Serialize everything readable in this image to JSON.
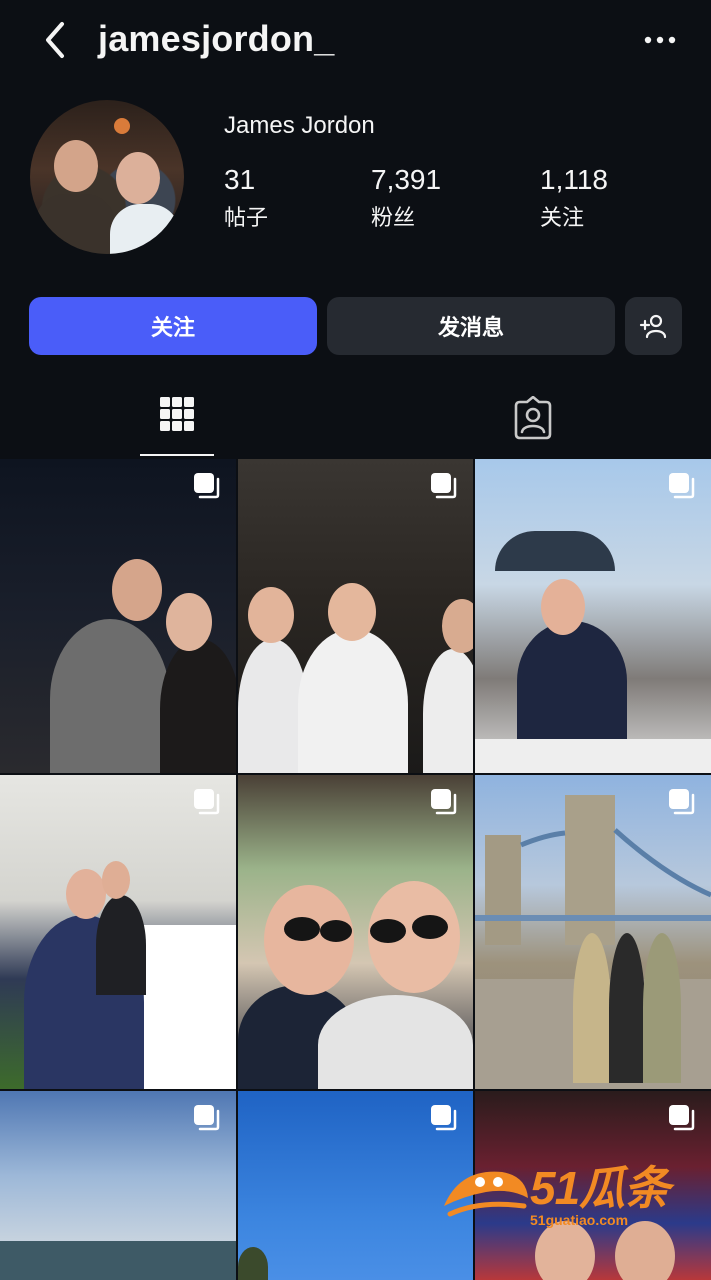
{
  "header": {
    "username": "jamesjordon_",
    "back_icon": "chevron-left-icon",
    "more_icon": "more-horizontal-icon"
  },
  "profile": {
    "full_name": "James Jordon",
    "stats": [
      {
        "value": "31",
        "label": "帖子"
      },
      {
        "value": "7,391",
        "label": "粉丝"
      },
      {
        "value": "1,118",
        "label": "关注"
      }
    ]
  },
  "actions": {
    "follow_label": "关注",
    "message_label": "发消息",
    "add_user_icon": "add-person-icon",
    "follow_color": "#4a5df9"
  },
  "tabs": {
    "grid_icon": "grid-icon",
    "tagged_icon": "tagged-person-icon",
    "active": "grid"
  },
  "posts": [
    {
      "multi": true
    },
    {
      "multi": true
    },
    {
      "multi": true
    },
    {
      "multi": true
    },
    {
      "multi": true
    },
    {
      "multi": true
    },
    {
      "multi": true
    },
    {
      "multi": true
    },
    {
      "multi": true
    }
  ],
  "watermark": {
    "text": "51瓜条",
    "sub": "51guatiao.com"
  }
}
